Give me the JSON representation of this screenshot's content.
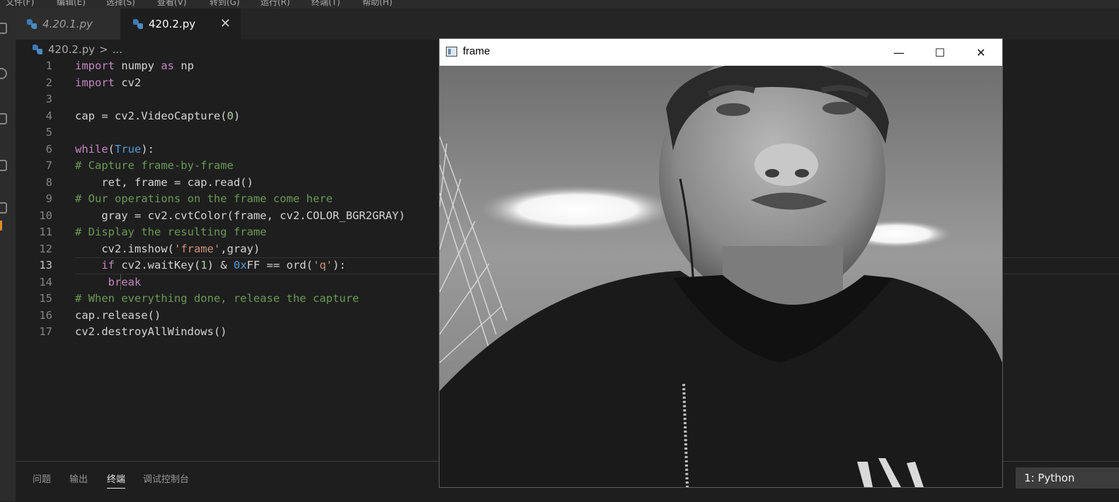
{
  "menu": {
    "items": [
      "文件(F)",
      "编辑(E)",
      "选择(S)",
      "查看(V)",
      "转到(G)",
      "运行(R)",
      "终端(T)",
      "帮助(H)"
    ]
  },
  "tabs": [
    {
      "label": "4.20.1.py",
      "active": false
    },
    {
      "label": "420.2.py",
      "active": true
    }
  ],
  "breadcrumb": {
    "file": "420.2.py",
    "separator": ">",
    "more": "..."
  },
  "editor": {
    "current_line": 13,
    "lines": [
      {
        "n": "1",
        "text": "import numpy as np"
      },
      {
        "n": "2",
        "text": "import cv2"
      },
      {
        "n": "3",
        "text": ""
      },
      {
        "n": "4",
        "text": "cap = cv2.VideoCapture(0)"
      },
      {
        "n": "5",
        "text": ""
      },
      {
        "n": "6",
        "text": "while(True):"
      },
      {
        "n": "7",
        "text": "# Capture frame-by-frame"
      },
      {
        "n": "8",
        "text": "    ret, frame = cap.read()"
      },
      {
        "n": "9",
        "text": "# Our operations on the frame come here"
      },
      {
        "n": "10",
        "text": "    gray = cv2.cvtColor(frame, cv2.COLOR_BGR2GRAY)"
      },
      {
        "n": "11",
        "text": "# Display the resulting frame"
      },
      {
        "n": "12",
        "text": "    cv2.imshow('frame',gray)"
      },
      {
        "n": "13",
        "text": "    if cv2.waitKey(1) & 0xFF == ord('q'):"
      },
      {
        "n": "14",
        "text": "     break"
      },
      {
        "n": "15",
        "text": "# When everything done, release the capture"
      },
      {
        "n": "16",
        "text": "cap.release()"
      },
      {
        "n": "17",
        "text": "cv2.destroyAllWindows()"
      }
    ]
  },
  "panel": {
    "tabs": [
      {
        "label": "问题",
        "active": false
      },
      {
        "label": "输出",
        "active": false
      },
      {
        "label": "终端",
        "active": true
      },
      {
        "label": "调试控制台",
        "active": false
      }
    ],
    "terminal_select": "1: Python"
  },
  "window": {
    "title": "frame",
    "controls": {
      "minimize": "—",
      "maximize": "☐",
      "close": "✕"
    }
  },
  "icons": {
    "tab_close": "✕"
  },
  "colors": {
    "editor_bg": "#1e1e1e",
    "keyword": "#c586c0",
    "builtin": "#569cd6",
    "function": "#dcdcaa",
    "comment": "#6a9955",
    "string": "#ce9178",
    "number": "#b5cea8"
  }
}
